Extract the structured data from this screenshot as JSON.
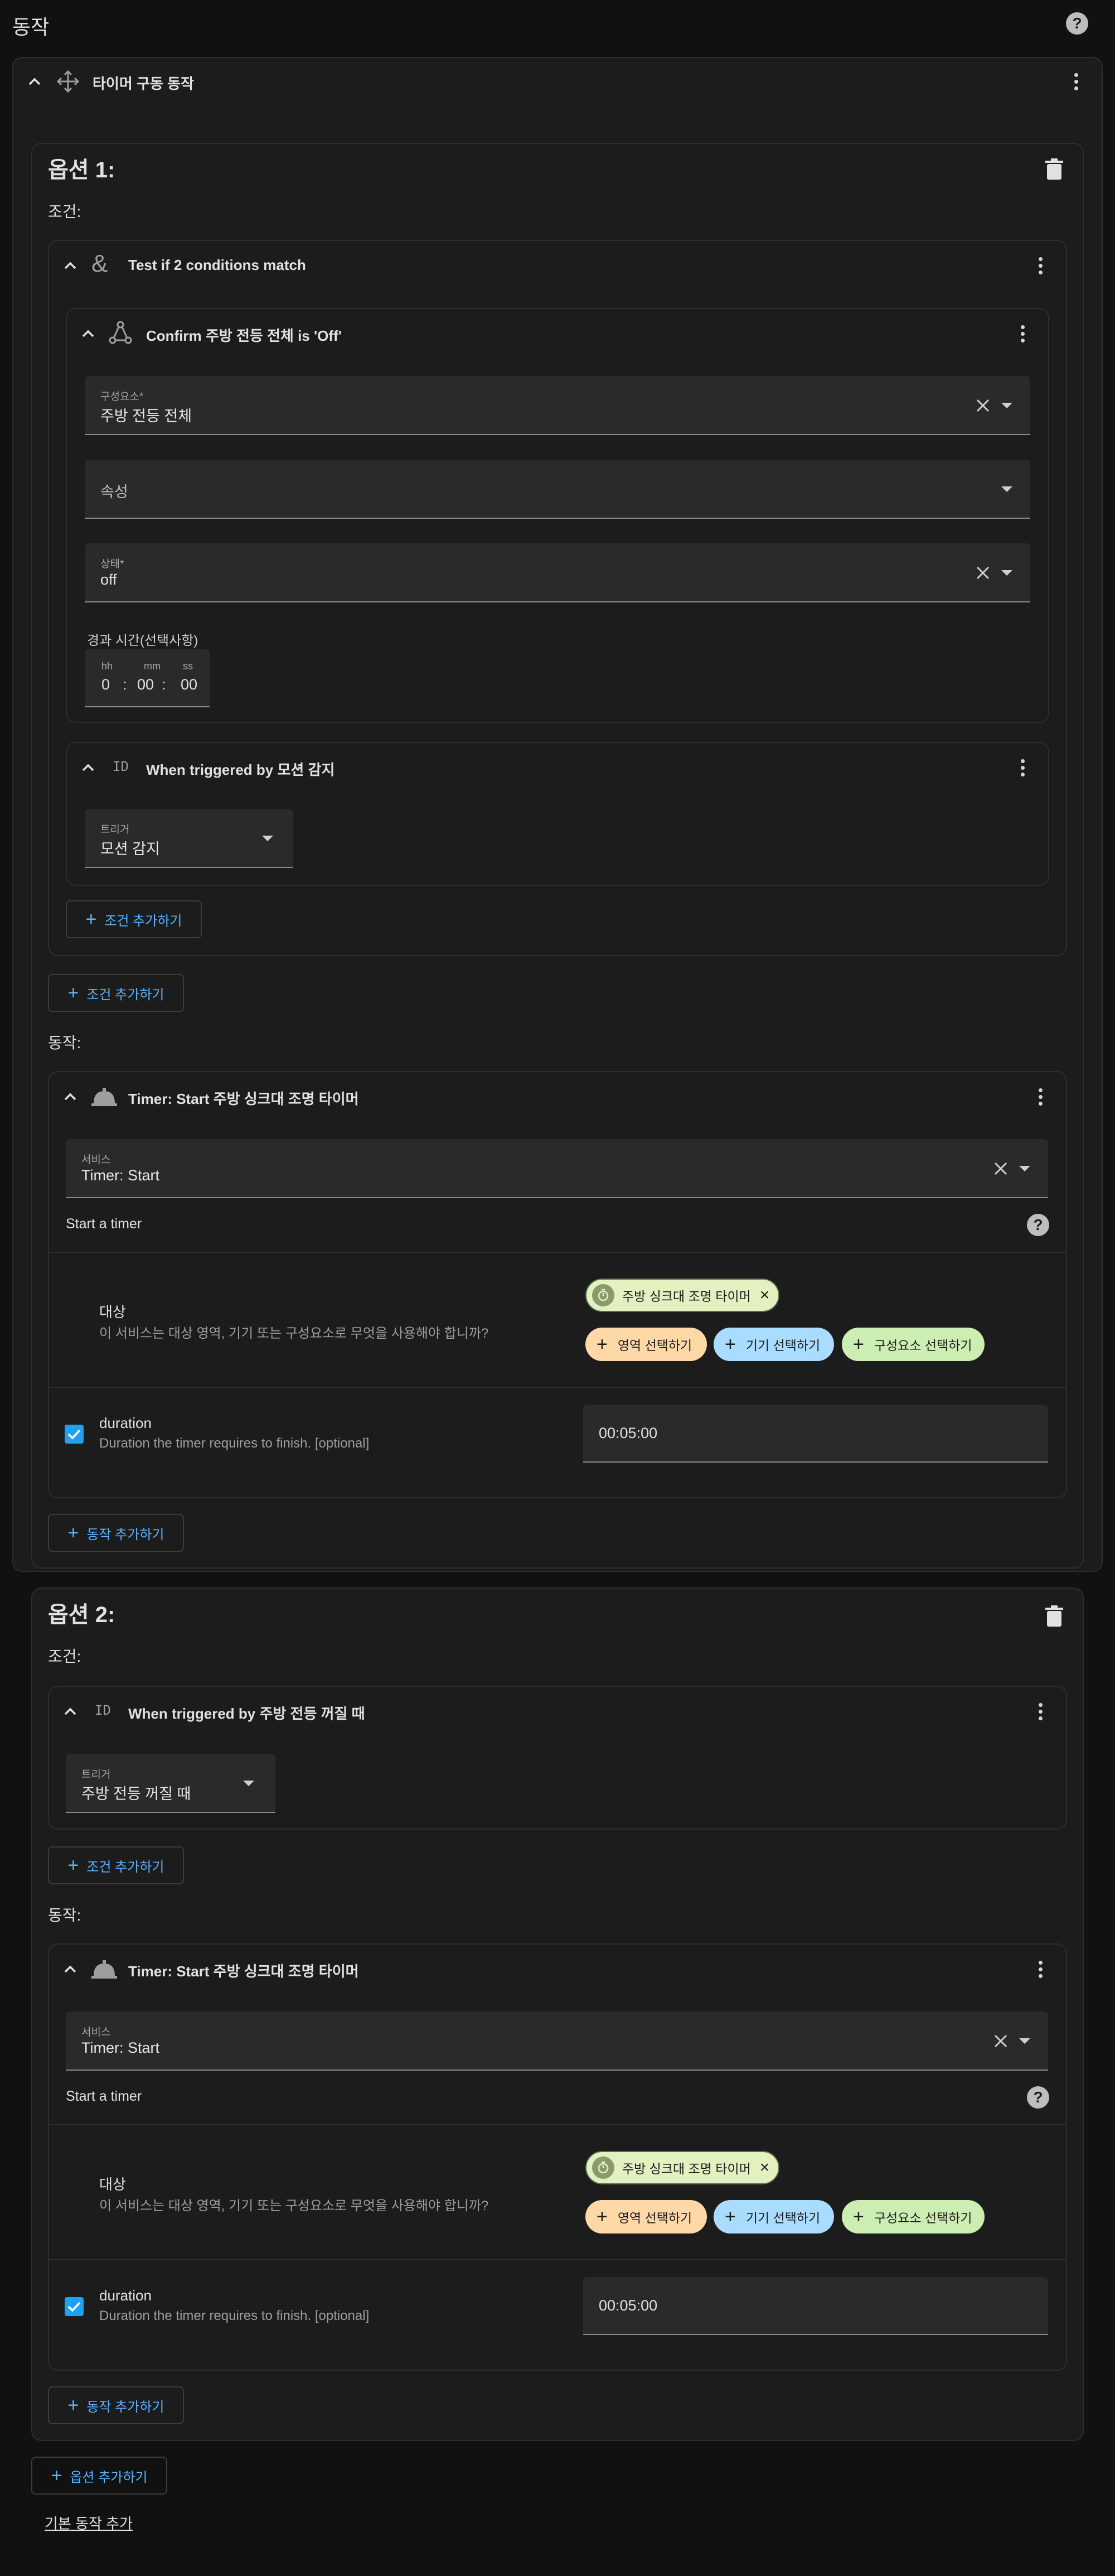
{
  "page": {
    "title": "동작",
    "add_option": "옵션 추가하기",
    "add_default": "기본 동작 추가"
  },
  "choose": {
    "title": "타이머 구동 동작"
  },
  "option1": {
    "title": "옵션 1:",
    "conditions_label": "조건:",
    "and": {
      "title": "Test if 2 conditions match",
      "state": {
        "title": "Confirm 주방 전등 전체 is 'Off'",
        "entity_label": "구성요소*",
        "entity_value": "주방 전등 전체",
        "attribute_placeholder": "속성",
        "state_label": "상태*",
        "state_value": "off",
        "duration_label": "경과 시간(선택사항)",
        "hh_label": "hh",
        "mm_label": "mm",
        "ss_label": "ss",
        "hh": "0",
        "mm": "00",
        "ss": "00",
        "sep": ":"
      },
      "trigger": {
        "title": "When triggered by 모션 감지",
        "field_label": "트리거",
        "field_value": "모션 감지"
      },
      "add_condition": "조건 추가하기"
    },
    "add_condition": "조건 추가하기",
    "actions_label": "동작:",
    "action": {
      "title": "Timer: Start 주방 싱크대 조명 타이머",
      "service_label": "서비스",
      "service_value": "Timer: Start",
      "description": "Start a timer",
      "target_title": "대상",
      "target_desc": "이 서비스는 대상 영역, 기기 또는 구성요소로 무엇을 사용해야 합니까?",
      "target_entity": "주방 싱크대 조명 타이머",
      "pick_area": "영역 선택하기",
      "pick_device": "기기 선택하기",
      "pick_entity": "구성요소 선택하기",
      "duration_title": "duration",
      "duration_desc": "Duration the timer requires to finish. [optional]",
      "duration_value": "00:05:00"
    },
    "add_action": "동작 추가하기"
  },
  "option2": {
    "title": "옵션 2:",
    "conditions_label": "조건:",
    "trigger": {
      "title": "When triggered by 주방 전등 꺼질 때",
      "field_label": "트리거",
      "field_value": "주방 전등 꺼질 때"
    },
    "add_condition": "조건 추가하기",
    "actions_label": "동작:",
    "action": {
      "title": "Timer: Start 주방 싱크대 조명 타이머",
      "service_label": "서비스",
      "service_value": "Timer: Start",
      "description": "Start a timer",
      "target_title": "대상",
      "target_desc": "이 서비스는 대상 영역, 기기 또는 구성요소로 무엇을 사용해야 합니까?",
      "target_entity": "주방 싱크대 조명 타이머",
      "pick_area": "영역 선택하기",
      "pick_device": "기기 선택하기",
      "pick_entity": "구성요소 선택하기",
      "duration_title": "duration",
      "duration_desc": "Duration the timer requires to finish. [optional]",
      "duration_value": "00:05:00"
    },
    "add_action": "동작 추가하기"
  },
  "icons": {
    "help": "?",
    "chip_close": "×",
    "plus": "+",
    "id_badge": "ID"
  },
  "colors": {
    "accent": "#5cb3ff",
    "chip_entity": "#e3f0c0",
    "chip_area": "#ffd8a8",
    "chip_device": "#a9dcff",
    "chip_entity_pick": "#cdeeb3",
    "checkbox": "#21a0f0"
  }
}
